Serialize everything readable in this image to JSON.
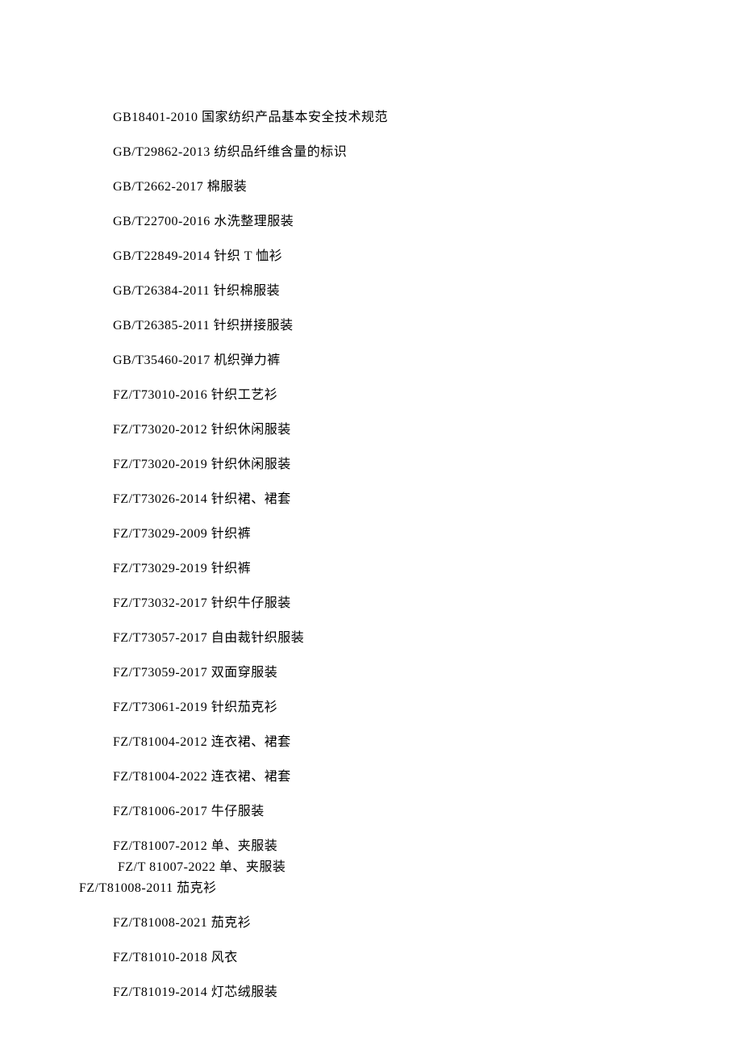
{
  "lines": [
    {
      "text": "GB18401-2010 国家纺织产品基本安全技术规范",
      "class": "line"
    },
    {
      "text": "GB/T29862-2013 纺织品纤维含量的标识",
      "class": "line"
    },
    {
      "text": "GB/T2662-2017 棉服装",
      "class": "line"
    },
    {
      "text": "GB/T22700-2016 水洗整理服装",
      "class": "line"
    },
    {
      "text": "GB/T22849-2014 针织 T 恤衫",
      "class": "line"
    },
    {
      "text": "GB/T26384-2011 针织棉服装",
      "class": "line"
    },
    {
      "text": "GB/T26385-2011 针织拼接服装",
      "class": "line"
    },
    {
      "text": "GB/T35460-2017 机织弹力裤",
      "class": "line"
    },
    {
      "text": "FZ/T73010-2016 针织工艺衫",
      "class": "line"
    },
    {
      "text": "FZ/T73020-2012 针织休闲服装",
      "class": "line"
    },
    {
      "text": "FZ/T73020-2019 针织休闲服装",
      "class": "line"
    },
    {
      "text": "FZ/T73026-2014 针织裙、裙套",
      "class": "line"
    },
    {
      "text": "FZ/T73029-2009 针织裤",
      "class": "line"
    },
    {
      "text": "FZ/T73029-2019 针织裤",
      "class": "line"
    },
    {
      "text": "FZ/T73032-2017 针织牛仔服装",
      "class": "line"
    },
    {
      "text": "FZ/T73057-2017 自由裁针织服装",
      "class": "line"
    },
    {
      "text": "FZ/T73059-2017 双面穿服装",
      "class": "line"
    },
    {
      "text": "FZ/T73061-2019 针织茄克衫",
      "class": "line"
    },
    {
      "text": "FZ/T81004-2012 连衣裙、裙套",
      "class": "line"
    },
    {
      "text": "FZ/T81004-2022 连衣裙、裙套",
      "class": "line"
    },
    {
      "text": "FZ/T81006-2017 牛仔服装",
      "class": "line"
    },
    {
      "text": "FZ/T81007-2012 单、夹服装",
      "class": "line-tight"
    },
    {
      "text": "FZ/T 81007-2022  单、夹服装",
      "class": "line-tight line-indent-small"
    },
    {
      "text": "FZ/T81008-2011 茄克衫",
      "class": "line line-outdent"
    },
    {
      "text": "FZ/T81008-2021 茄克衫",
      "class": "line"
    },
    {
      "text": "FZ/T81010-2018 风衣",
      "class": "line"
    },
    {
      "text": "FZ/T81019-2014 灯芯绒服装",
      "class": "line"
    }
  ]
}
